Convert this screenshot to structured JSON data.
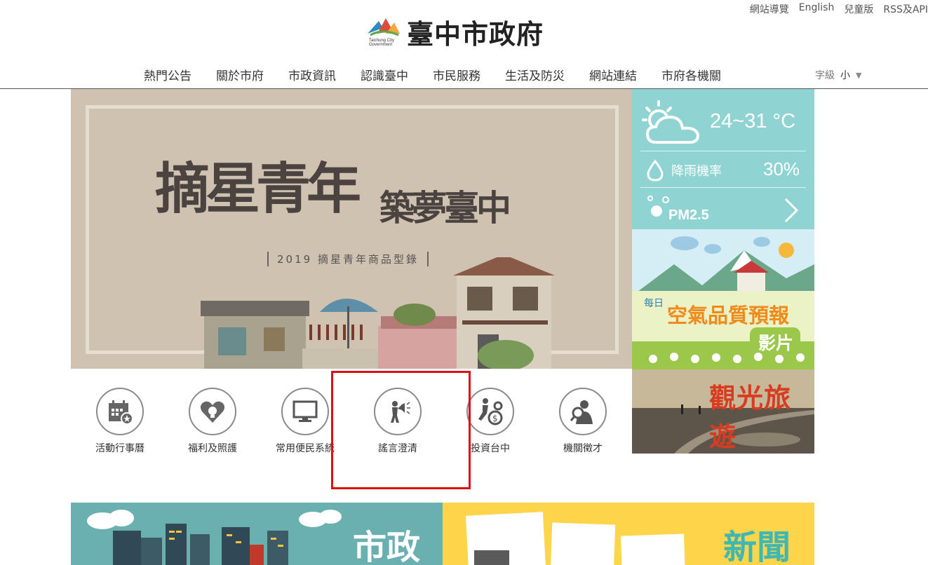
{
  "top_links": [
    "網站導覽",
    "English",
    "兒童版",
    "RSS及API"
  ],
  "logo": {
    "name": "臺中市政府",
    "english": "Taichung City Government"
  },
  "nav": [
    "熱門公告",
    "關於市府",
    "市政資訊",
    "認識臺中",
    "市民服務",
    "生活及防災",
    "網站連結",
    "市府各機關"
  ],
  "font_size": {
    "label": "字級",
    "value": "小",
    "arrow": "▼"
  },
  "banner": {
    "line1": "摘星青年",
    "line2": "築夢臺中",
    "subtitle": "2019 摘星青年商品型錄"
  },
  "weather": {
    "temperature": "24~31 °C",
    "rain_label": "降雨機率",
    "rain_value": "30%",
    "pm_label": "PM2.5"
  },
  "air_quality": {
    "daily": "每日",
    "title": "空氣品質預報",
    "video": "影片"
  },
  "tourism": {
    "title": "觀光旅遊"
  },
  "quick_links": [
    {
      "label": "活動行事曆"
    },
    {
      "label": "福利及照護"
    },
    {
      "label": "常用便民系統"
    },
    {
      "label": "謠言澄清"
    },
    {
      "label": "投資台中"
    },
    {
      "label": "機關徵才"
    }
  ],
  "sections": {
    "city_gov": "市政",
    "news": "新聞"
  },
  "colors": {
    "weather_bg": "#8fd3d2",
    "highlight": "#d11111",
    "news_bg": "#fcd54b",
    "city_bg": "#6bb0b0"
  }
}
